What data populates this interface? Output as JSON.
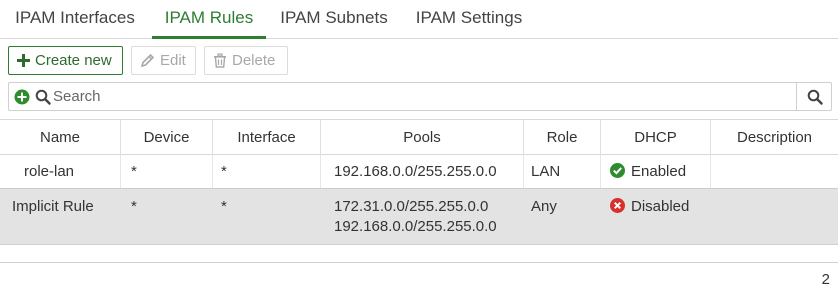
{
  "tabs": [
    {
      "label": "IPAM Interfaces",
      "active": false
    },
    {
      "label": "IPAM Rules",
      "active": true
    },
    {
      "label": "IPAM Subnets",
      "active": false
    },
    {
      "label": "IPAM Settings",
      "active": false
    }
  ],
  "toolbar": {
    "create_label": "Create new",
    "edit_label": "Edit",
    "delete_label": "Delete"
  },
  "search": {
    "placeholder": "Search"
  },
  "table": {
    "columns": [
      "Name",
      "Device",
      "Interface",
      "Pools",
      "Role",
      "DHCP",
      "Description"
    ],
    "rows": [
      {
        "name": "role-lan",
        "device": "*",
        "interface": "*",
        "pools": [
          "192.168.0.0/255.255.0.0"
        ],
        "role": "LAN",
        "dhcp": "Enabled",
        "dhcp_status_icon": "check-circle-icon",
        "description": ""
      },
      {
        "name": "Implicit Rule",
        "device": "*",
        "interface": "*",
        "pools": [
          "172.31.0.0/255.255.0.0",
          "192.168.0.0/255.255.0.0"
        ],
        "role": "Any",
        "dhcp": "Disabled",
        "dhcp_status_icon": "x-circle-icon",
        "description": ""
      }
    ]
  },
  "footer": {
    "count": "2"
  },
  "colors": {
    "accent": "#2e7d32",
    "enabled": "#2e8b2e",
    "disabled": "#d9302c",
    "selected_row": "#e3e3e3"
  }
}
